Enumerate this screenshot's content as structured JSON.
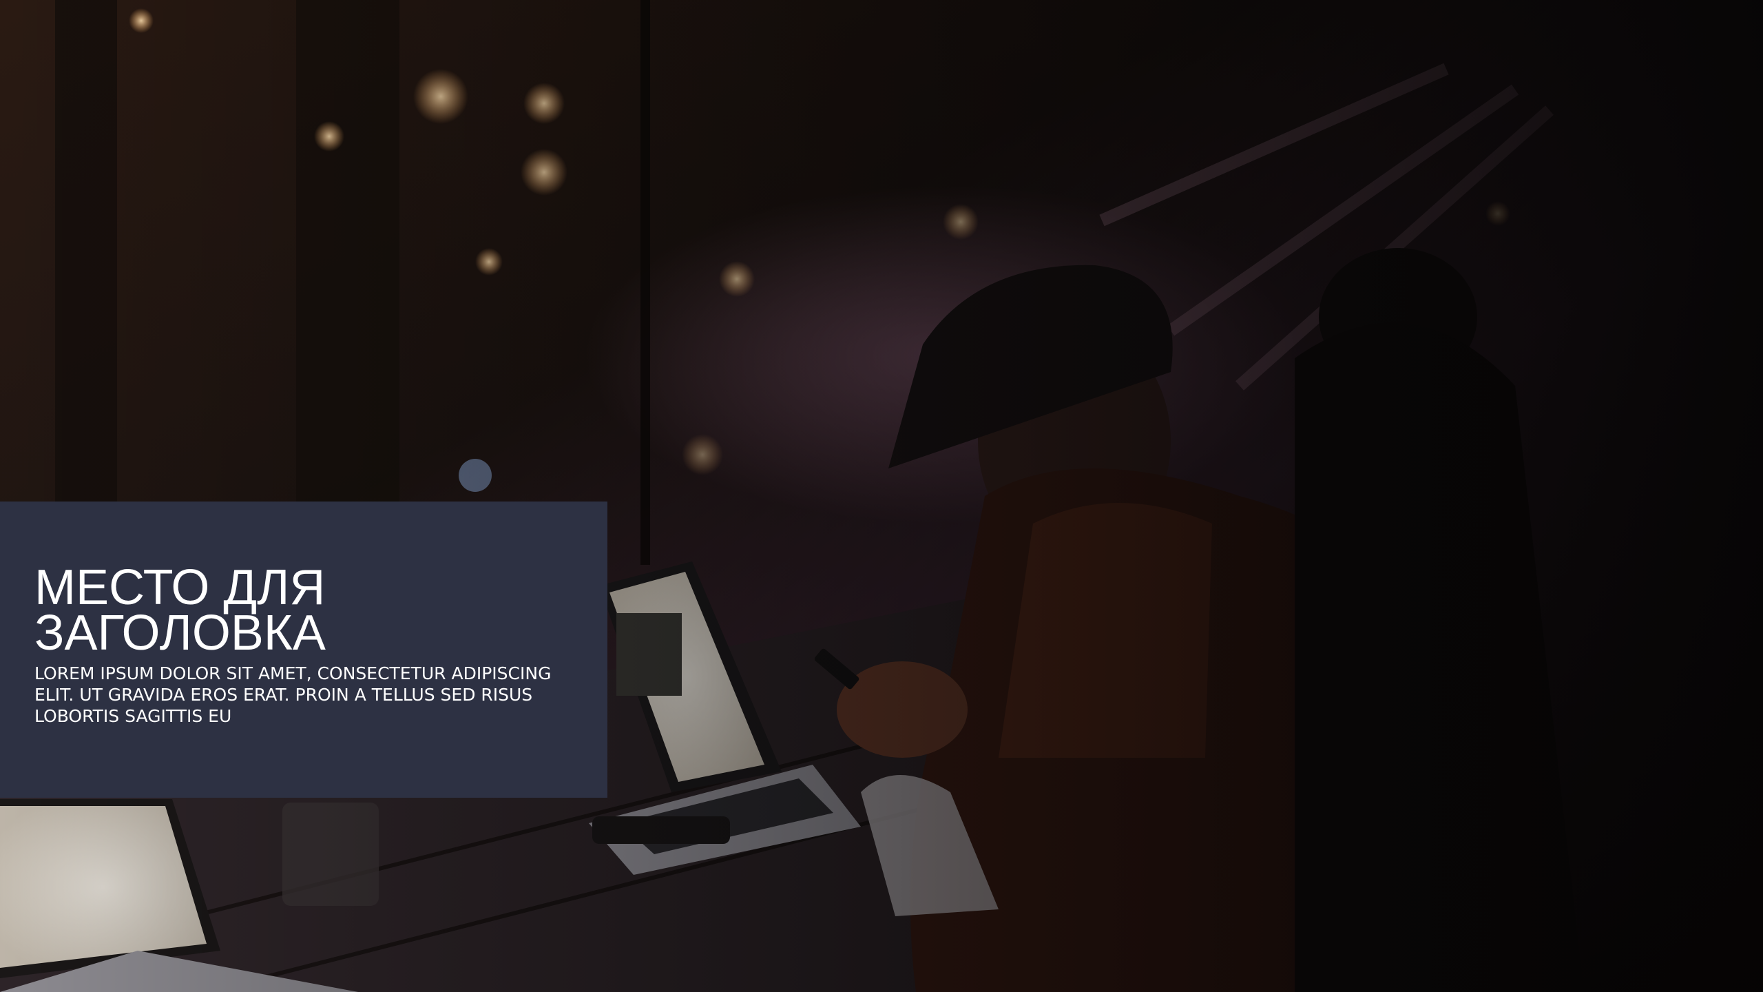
{
  "slide": {
    "title": "МЕСТО ДЛЯ ЗАГОЛОВКА",
    "body": "LOREM IPSUM DOLOR SIT AMET, CONSECTETUR ADIPISCING ELIT. UT GRAVIDA EROS ERAT. PROIN A TELLUS SED RISUS LOBORTIS SAGITTIS EU",
    "panel_color": "#2d3143",
    "text_color": "#ffffff"
  },
  "background_photo": {
    "subject": "people-working-on-laptops-at-night-cafe",
    "icon": "photo-icon"
  }
}
